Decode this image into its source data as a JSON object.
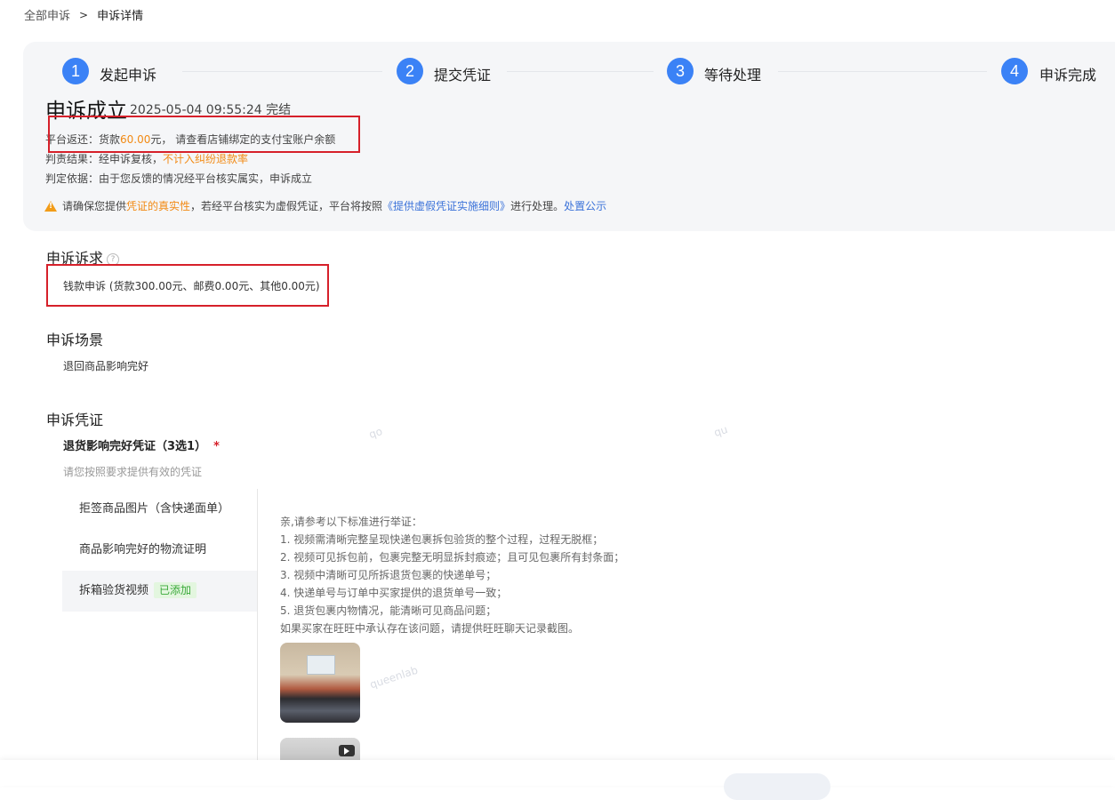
{
  "breadcrumb": {
    "root": "全部申诉",
    "separator": ">",
    "current": "申诉详情"
  },
  "steps": [
    {
      "num": "1",
      "label": "发起申诉"
    },
    {
      "num": "2",
      "label": "提交凭证"
    },
    {
      "num": "3",
      "label": "等待处理"
    },
    {
      "num": "4",
      "label": "申诉完成"
    }
  ],
  "result": {
    "title": "申诉成立",
    "time": "2025-05-04 09:55:24 完结",
    "refund_prefix": "平台返还：货款",
    "refund_amount": "60.00",
    "refund_suffix": "元， 请查看店铺绑定的支付宝账户余额",
    "verdict_prefix": "判责结果：经申诉复核，",
    "verdict_highlight": "不计入纠纷退款率",
    "basis": "判定依据：由于您反馈的情况经平台核实属实，申诉成立",
    "warn_prefix": "请确保您提供",
    "warn_highlight": "凭证的真实性",
    "warn_middle": "，若经平台核实为虚假凭证，平台将按照",
    "warn_link": "《提供虚假凭证实施细则》",
    "warn_after": "进行处理。",
    "warn_link2": "处置公示"
  },
  "claim": {
    "title": "申诉诉求",
    "help_icon": "question-icon",
    "text": "钱款申诉 (货款300.00元、邮费0.00元、其他0.00元)"
  },
  "scene": {
    "title": "申诉场景",
    "text": "退回商品影响完好"
  },
  "evidence": {
    "title": "申诉凭证",
    "subtitle": "退货影响完好凭证（3选1）",
    "required": "*",
    "hint": "请您按照要求提供有效的凭证",
    "tabs": [
      {
        "label": "拒签商品图片（含快递面单）"
      },
      {
        "label": "商品影响完好的物流证明"
      },
      {
        "label": "拆箱验货视频",
        "badge": "已添加"
      }
    ],
    "guide": [
      "亲,请参考以下标准进行举证：",
      "1. 视频需清晰完整呈现快递包裹拆包验货的整个过程，过程无脱框；",
      "2. 视频可见拆包前，包裹完整无明显拆封痕迹；且可见包裹所有封条面；",
      "3. 视频中清晰可见所拆退货包裹的快递单号；",
      "4. 快递单号与订单中买家提供的退货单号一致；",
      "5. 退货包裹内物情况，能清晰可见商品问题；",
      "如果买家在旺旺中承认存在该问题，请提供旺旺聊天记录截图。"
    ]
  },
  "watermarks": [
    "queenlab",
    "qu",
    "qo",
    "queenlab",
    "qu"
  ],
  "colors": {
    "accent": "#3b82f6",
    "highlight": "#f28a14",
    "annotation": "#d6202a",
    "link": "#3b72d9",
    "added": "#3aa93a"
  }
}
